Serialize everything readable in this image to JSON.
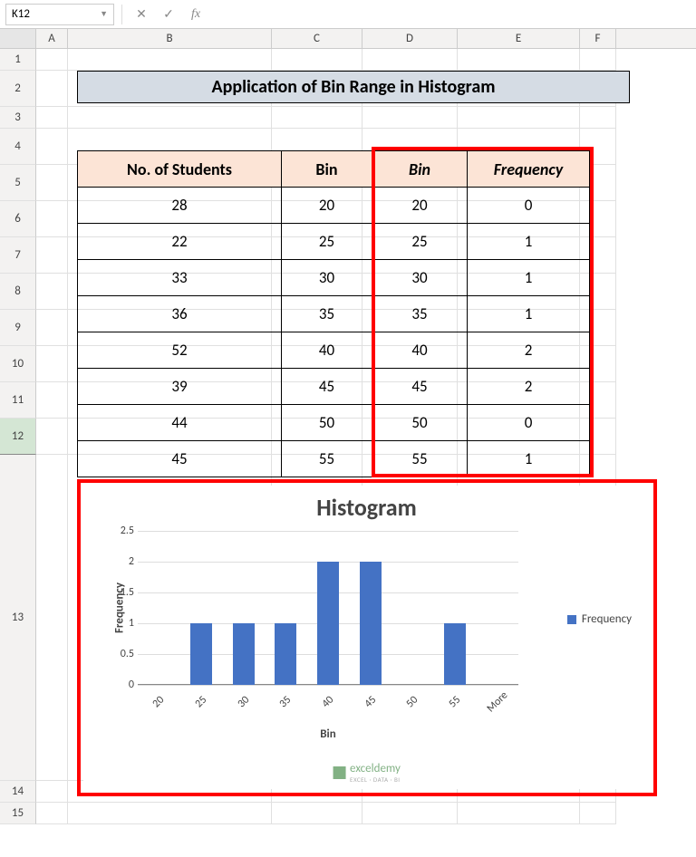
{
  "formula_bar": {
    "name_box": "K12",
    "fx_label": "fx"
  },
  "columns": [
    "A",
    "B",
    "C",
    "D",
    "E",
    "F"
  ],
  "row_numbers": [
    "1",
    "2",
    "3",
    "4",
    "5",
    "6",
    "7",
    "8",
    "9",
    "10",
    "11",
    "12",
    "13",
    "14",
    "15"
  ],
  "title": "Application of Bin Range in Histogram",
  "table": {
    "headers": {
      "b": "No. of Students",
      "c": "Bin",
      "d": "Bin",
      "e": "Frequency"
    },
    "rows": [
      {
        "b": "28",
        "c": "20",
        "d": "20",
        "e": "0"
      },
      {
        "b": "22",
        "c": "25",
        "d": "25",
        "e": "1"
      },
      {
        "b": "33",
        "c": "30",
        "d": "30",
        "e": "1"
      },
      {
        "b": "36",
        "c": "35",
        "d": "35",
        "e": "1"
      },
      {
        "b": "52",
        "c": "40",
        "d": "40",
        "e": "2"
      },
      {
        "b": "39",
        "c": "45",
        "d": "45",
        "e": "2"
      },
      {
        "b": "44",
        "c": "50",
        "d": "50",
        "e": "0"
      },
      {
        "b": "45",
        "c": "55",
        "d": "55",
        "e": "1"
      }
    ]
  },
  "chart_data": {
    "type": "bar",
    "title": "Histogram",
    "xlabel": "Bin",
    "ylabel": "Frequency",
    "ylim": [
      0,
      2.5
    ],
    "y_ticks": [
      0,
      0.5,
      1,
      1.5,
      2,
      2.5
    ],
    "categories": [
      "20",
      "25",
      "30",
      "35",
      "40",
      "45",
      "50",
      "55",
      "More"
    ],
    "series": [
      {
        "name": "Frequency",
        "values": [
          0,
          1,
          1,
          1,
          2,
          2,
          0,
          1,
          0
        ]
      }
    ],
    "legend_position": "right"
  },
  "watermark": {
    "brand": "exceldemy",
    "sub": "EXCEL · DATA · BI"
  }
}
